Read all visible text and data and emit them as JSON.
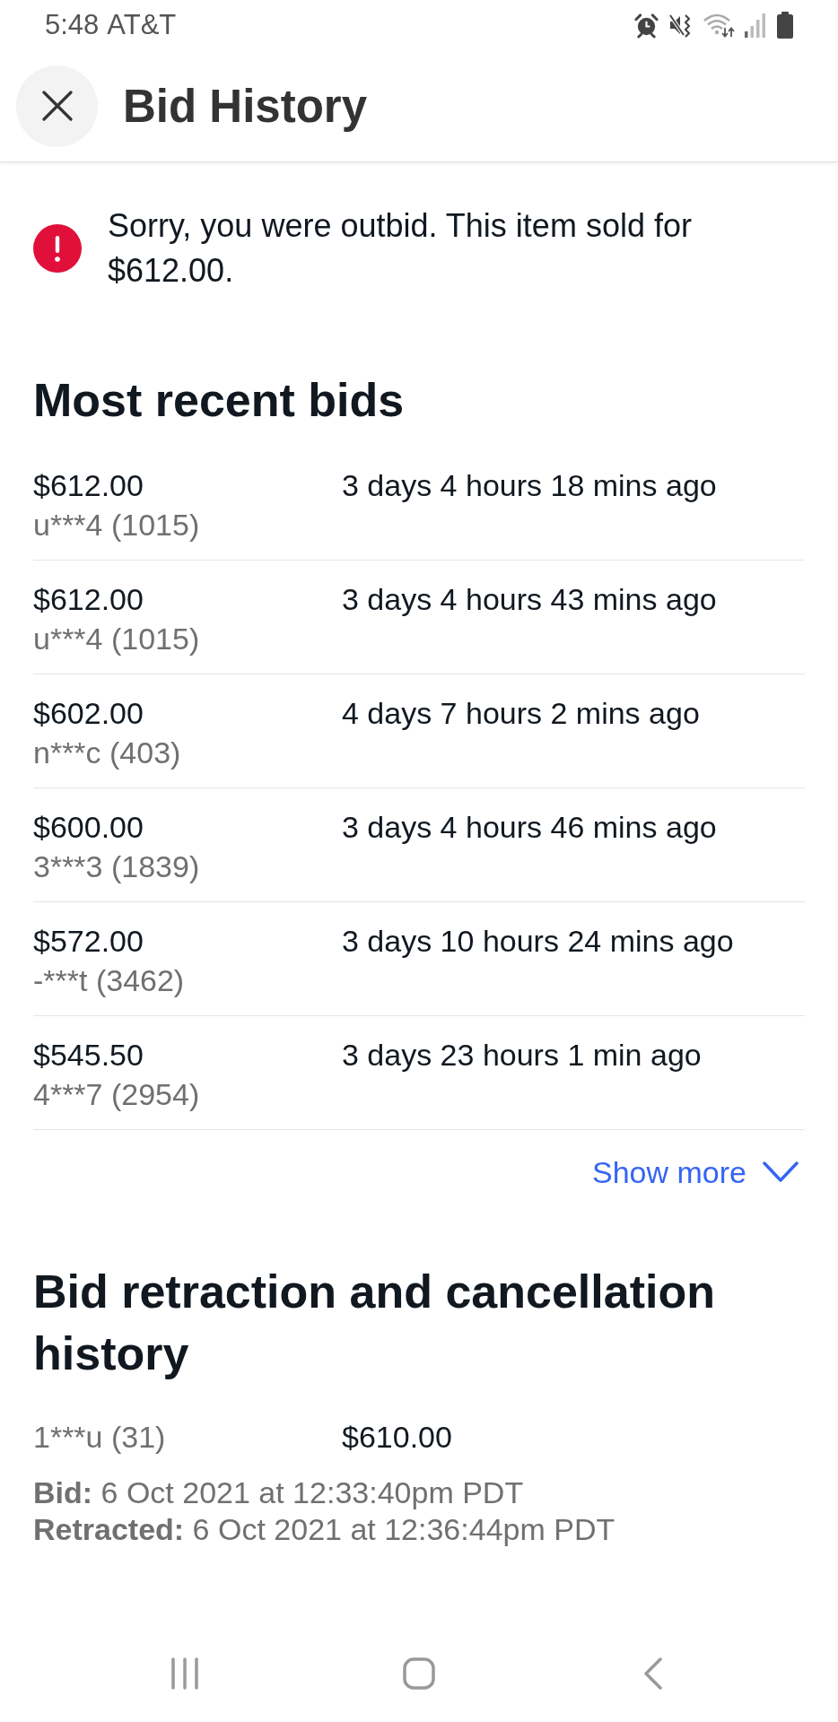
{
  "status_bar": {
    "time": "5:48",
    "carrier": "AT&T"
  },
  "header": {
    "title": "Bid History"
  },
  "alert": {
    "message": "Sorry, you were outbid. This item sold for $612.00."
  },
  "recent_bids": {
    "heading": "Most recent bids",
    "bids": [
      {
        "amount": "$612.00",
        "bidder": "u***4 (1015)",
        "time": "3 days 4 hours 18 mins ago"
      },
      {
        "amount": "$612.00",
        "bidder": "u***4 (1015)",
        "time": "3 days 4 hours 43 mins ago"
      },
      {
        "amount": "$602.00",
        "bidder": "n***c (403)",
        "time": "4 days 7 hours 2 mins ago"
      },
      {
        "amount": "$600.00",
        "bidder": "3***3 (1839)",
        "time": "3 days 4 hours 46 mins ago"
      },
      {
        "amount": "$572.00",
        "bidder": "-***t (3462)",
        "time": "3 days 10 hours 24 mins ago"
      },
      {
        "amount": "$545.50",
        "bidder": "4***7 (2954)",
        "time": "3 days 23 hours 1 min ago"
      }
    ],
    "show_more": "Show more"
  },
  "retraction_history": {
    "heading": "Bid retraction and cancellation history",
    "entries": [
      {
        "bidder": "1***u (31)",
        "amount": "$610.00",
        "bid_line": "**Bid:** 6 Oct 2021 at 12:33:40pm PDT",
        "retracted_line": "**Retracted:** 6 Oct 2021 at 12:36:44pm PDT"
      }
    ]
  }
}
